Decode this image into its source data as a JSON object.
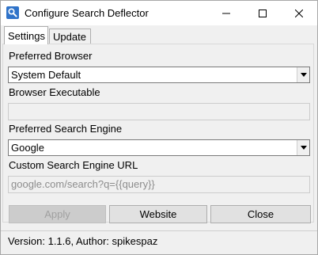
{
  "window": {
    "title": "Configure Search Deflector",
    "icon": "search-deflector-app-icon",
    "controls": [
      "minimize-icon",
      "maximize-icon",
      "close-icon"
    ]
  },
  "tabs": [
    {
      "label": "Settings",
      "selected": true
    },
    {
      "label": "Update",
      "selected": false
    }
  ],
  "settings": {
    "preferred_browser_label": "Preferred Browser",
    "preferred_browser_value": "System Default",
    "browser_executable_label": "Browser Executable",
    "browser_executable_value": "",
    "preferred_engine_label": "Preferred Search Engine",
    "preferred_engine_value": "Google",
    "custom_url_label": "Custom Search Engine URL",
    "custom_url_value": "google.com/search?q={{query}}"
  },
  "buttons": {
    "apply": "Apply",
    "website": "Website",
    "close": "Close"
  },
  "status": "Version: 1.1.6, Author: spikespaz",
  "colors": {
    "window_bg": "#f0f0f0",
    "disabled_text": "#a0a0a0",
    "icon_blue": "#2f73c9"
  }
}
